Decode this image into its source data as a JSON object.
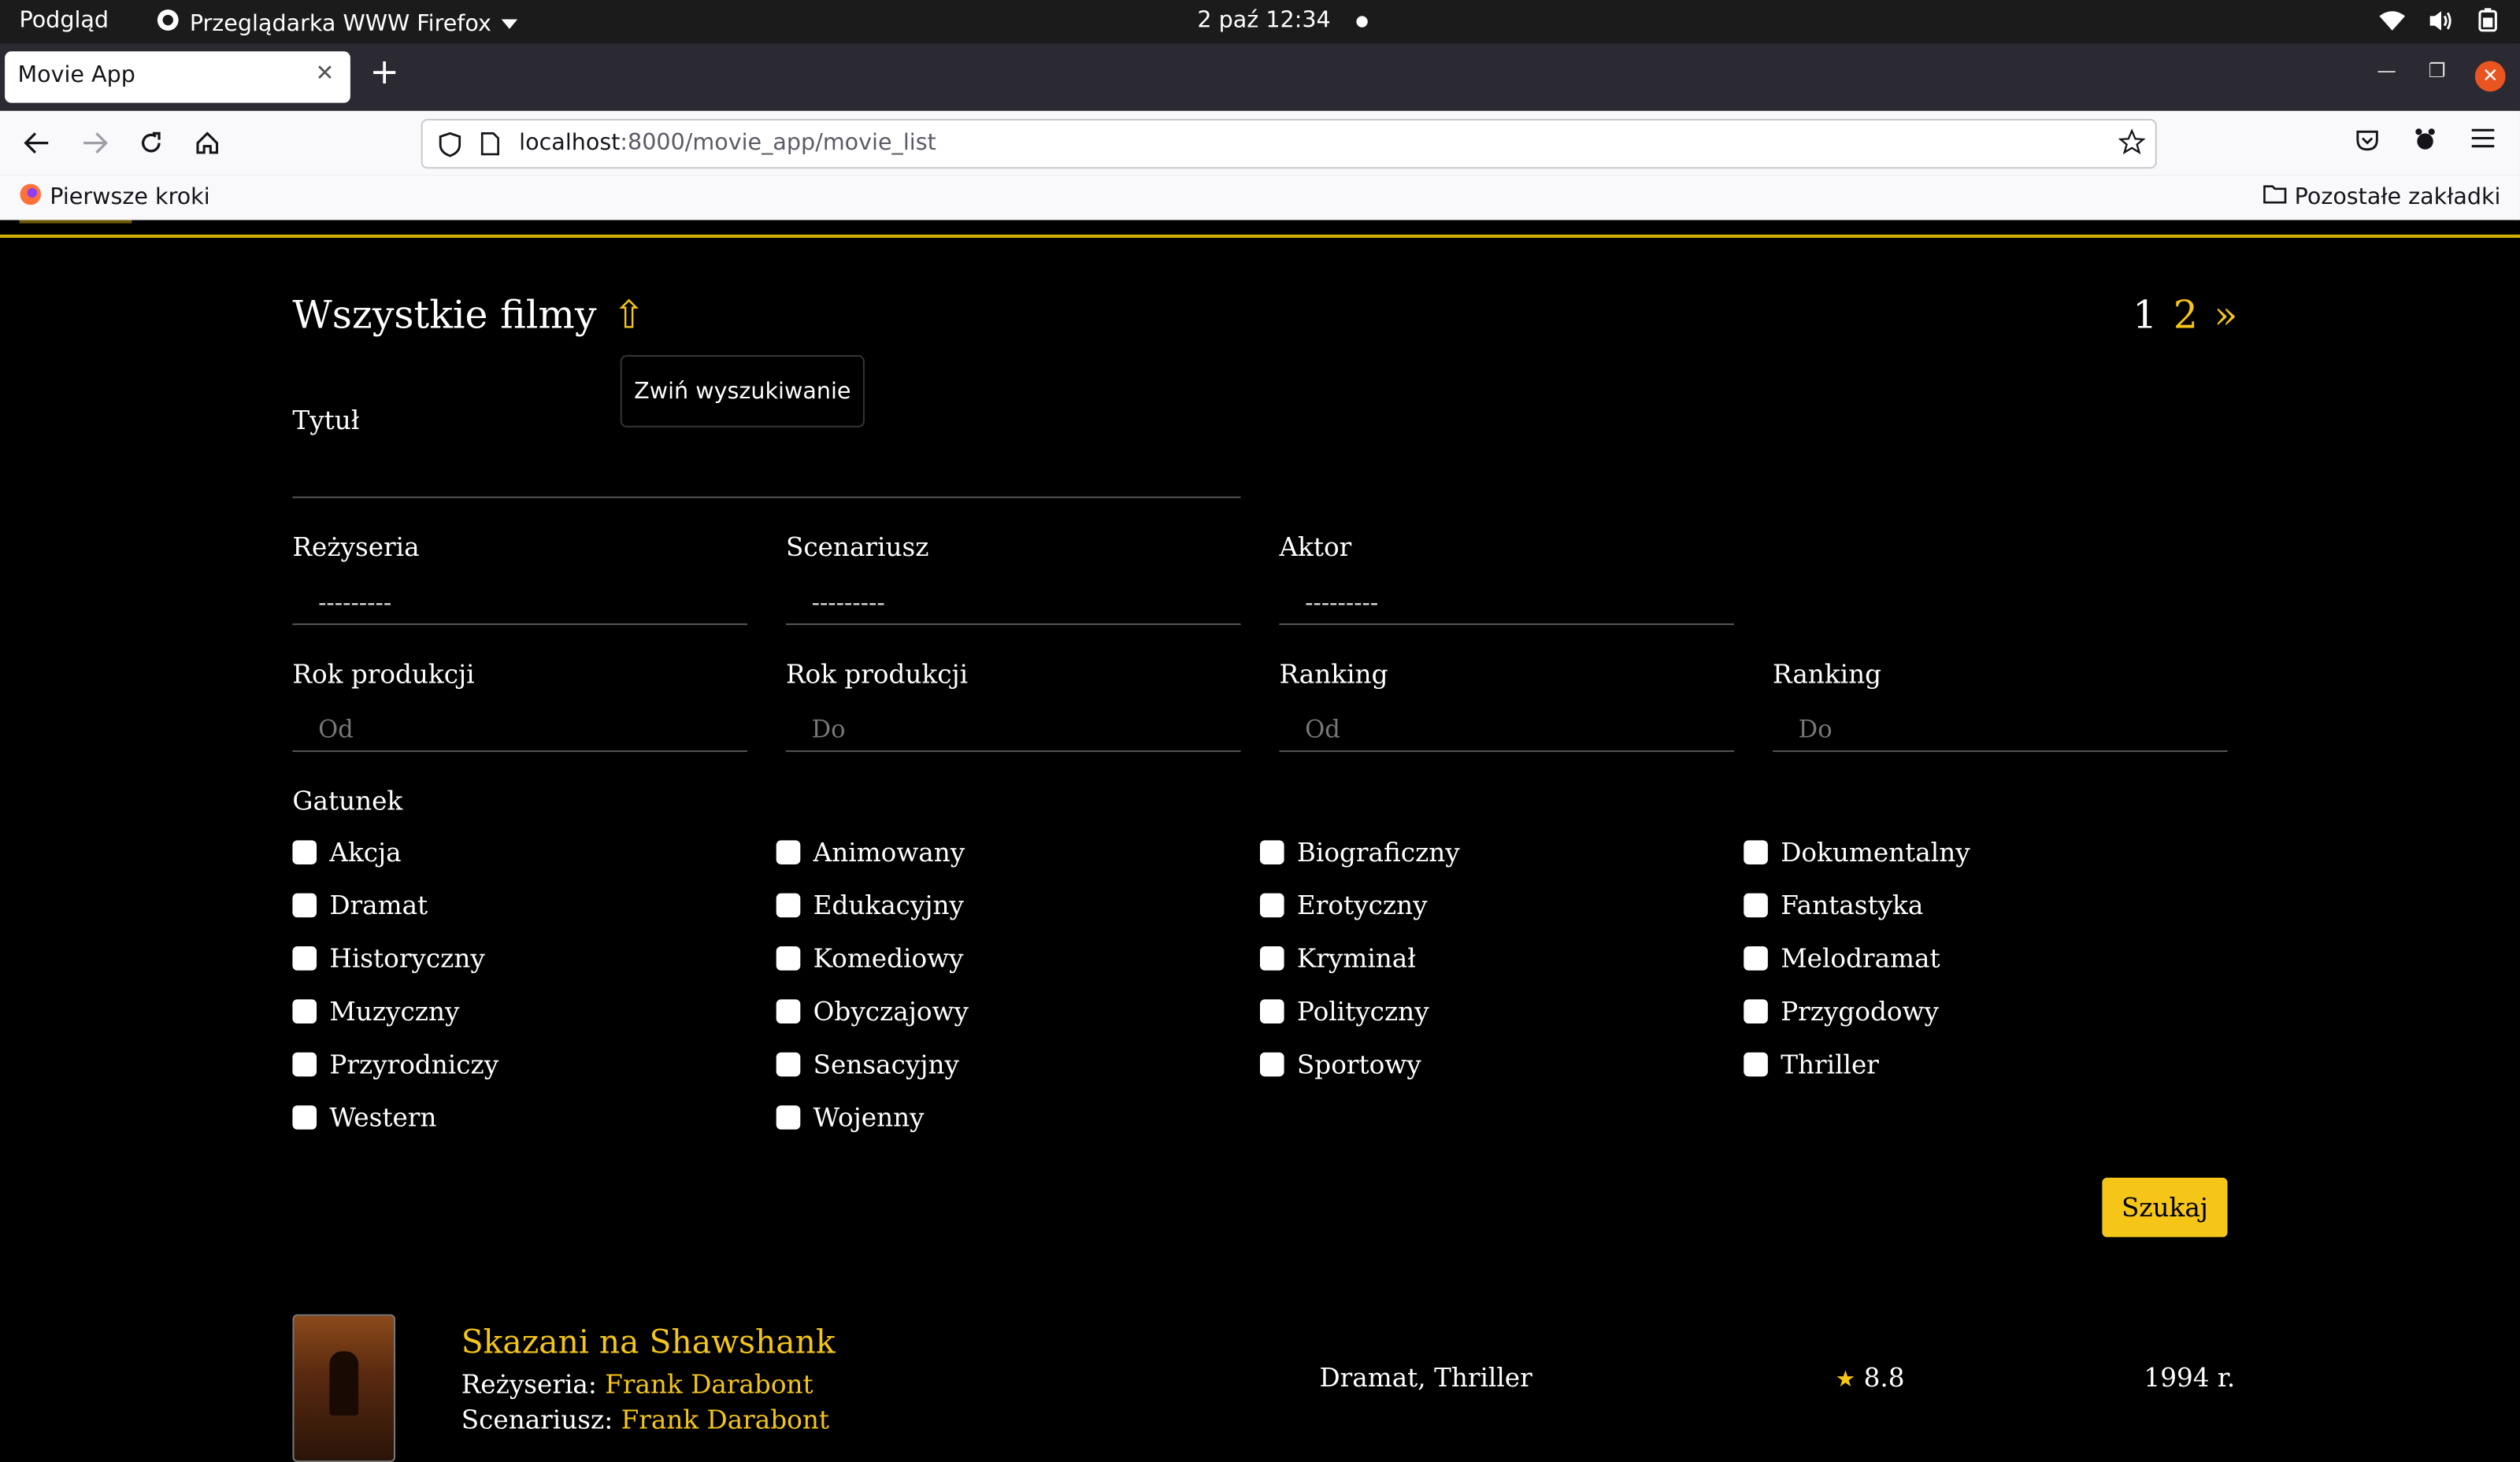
{
  "os": {
    "activities": "Podgląd",
    "app_name": "Przeglądarka WWW Firefox",
    "clock": "2 paź  12:34"
  },
  "browser": {
    "tab_title": "Movie App",
    "url_host": "localhost",
    "url_rest": ":8000/movie_app/movie_list",
    "bookmark_left": "Pierwsze kroki",
    "bookmark_right": "Pozostałe zakładki"
  },
  "search": {
    "page_title": "Wszystkie filmy",
    "toggle_icon": "⇧",
    "tooltip": "Zwiń wyszukiwanie",
    "pagination": {
      "current": "1",
      "next_page": "2",
      "next_arrow": "»"
    },
    "title_label": "Tytuł",
    "director_label": "Reżyseria",
    "director_value": "---------",
    "writer_label": "Scenariusz",
    "writer_value": "---------",
    "actor_label": "Aktor",
    "actor_value": "---------",
    "year_from_label": "Rok produkcji",
    "year_from_placeholder": "Od",
    "year_to_label": "Rok produkcji",
    "year_to_placeholder": "Do",
    "rank_from_label": "Ranking",
    "rank_from_placeholder": "Od",
    "rank_to_label": "Ranking",
    "rank_to_placeholder": "Do",
    "genre_label": "Gatunek",
    "genres": [
      "Akcja",
      "Animowany",
      "Biograficzny",
      "Dokumentalny",
      "Dramat",
      "Edukacyjny",
      "Erotyczny",
      "Fantastyka",
      "Historyczny",
      "Komediowy",
      "Kryminał",
      "Melodramat",
      "Muzyczny",
      "Obyczajowy",
      "Polityczny",
      "Przygodowy",
      "Przyrodniczy",
      "Sensacyjny",
      "Sportowy",
      "Thriller",
      "Western",
      "Wojenny"
    ],
    "submit": "Szukaj"
  },
  "movies": [
    {
      "title": "Skazani na Shawshank",
      "director_label": "Reżyseria: ",
      "director": "Frank Darabont",
      "writer_label": "Scenariusz: ",
      "writer": "Frank Darabont",
      "genres": "Dramat, Thriller",
      "star": "★",
      "rating": "8.8",
      "year": "1994 r."
    }
  ],
  "colors": {
    "accent": "#f5c518",
    "background": "#000000",
    "ubuntu_close": "#e95420"
  }
}
